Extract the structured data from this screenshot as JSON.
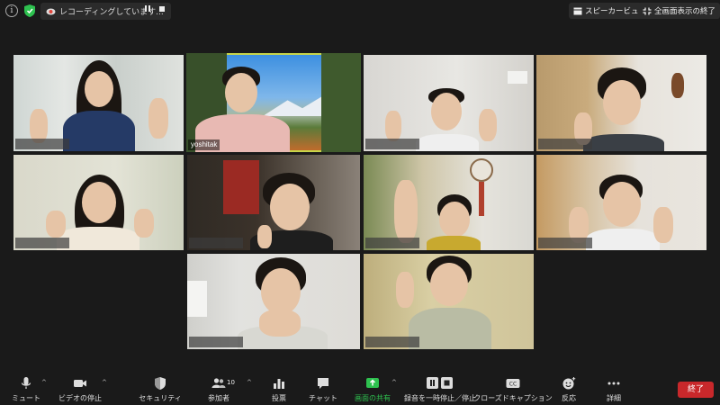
{
  "top_bar": {
    "recording_text": "レコーディングしています...",
    "speaker_view_label": "スピーカービュー",
    "exit_fullscreen_label": "全画面表示の終了"
  },
  "gallery": {
    "tiles": [
      {
        "name": ""
      },
      {
        "name": "yoshitak"
      },
      {
        "name": ""
      },
      {
        "name": ""
      },
      {
        "name": ""
      },
      {
        "name": ""
      },
      {
        "name": ""
      },
      {
        "name": ""
      },
      {
        "name": ""
      },
      {
        "name": ""
      }
    ]
  },
  "toolbar": {
    "mute_label": "ミュート",
    "stop_video_label": "ビデオの停止",
    "security_label": "セキュリティ",
    "participants_label": "参加者",
    "participants_count": "10",
    "polls_label": "投票",
    "chat_label": "チャット",
    "share_screen_label": "画面の共有",
    "pause_stop_recording_label": "録音を一時停止／停止",
    "closed_caption_label": "クローズドキャプション",
    "reactions_label": "反応",
    "more_label": "詳細",
    "end_label": "終了"
  },
  "colors": {
    "accent_green": "#2ec14f",
    "active_speaker_border": "#c8d54a",
    "end_red": "#c8282b"
  }
}
